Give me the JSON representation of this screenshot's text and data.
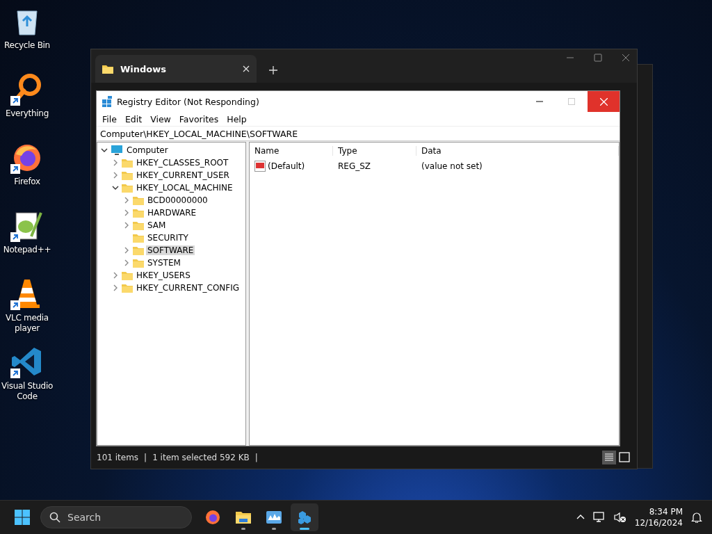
{
  "desktop_icons": [
    {
      "kind": "recycle-bin",
      "label": "Recycle Bin",
      "shortcut": false
    },
    {
      "kind": "everything",
      "label": "Everything",
      "shortcut": true
    },
    {
      "kind": "firefox",
      "label": "Firefox",
      "shortcut": true
    },
    {
      "kind": "notepad",
      "label": "Notepad++",
      "shortcut": true
    },
    {
      "kind": "vlc",
      "label": "VLC media player",
      "shortcut": true
    },
    {
      "kind": "vscode",
      "label": "Visual Studio Code",
      "shortcut": true
    }
  ],
  "explorer": {
    "tab_title": "Windows",
    "status_bar": [
      "101 items",
      "|",
      "1 item selected  592 KB",
      "|"
    ]
  },
  "registry_editor": {
    "title": "Registry Editor (Not Responding)",
    "menu": [
      "File",
      "Edit",
      "View",
      "Favorites",
      "Help"
    ],
    "address": "Computer\\HKEY_LOCAL_MACHINE\\SOFTWARE",
    "tree": [
      {
        "label": "Computer",
        "kind": "computer",
        "expandable": true,
        "expanded": true,
        "selected": false,
        "children": [
          {
            "label": "HKEY_CLASSES_ROOT",
            "expandable": true,
            "expanded": false,
            "selected": false
          },
          {
            "label": "HKEY_CURRENT_USER",
            "expandable": true,
            "expanded": false,
            "selected": false
          },
          {
            "label": "HKEY_LOCAL_MACHINE",
            "expandable": true,
            "expanded": true,
            "selected": false,
            "children": [
              {
                "label": "BCD00000000",
                "expandable": true,
                "expanded": false,
                "selected": false
              },
              {
                "label": "HARDWARE",
                "expandable": true,
                "expanded": false,
                "selected": false
              },
              {
                "label": "SAM",
                "expandable": true,
                "expanded": false,
                "selected": false
              },
              {
                "label": "SECURITY",
                "expandable": false,
                "expanded": false,
                "selected": false
              },
              {
                "label": "SOFTWARE",
                "expandable": true,
                "expanded": false,
                "selected": true
              },
              {
                "label": "SYSTEM",
                "expandable": true,
                "expanded": false,
                "selected": false
              }
            ]
          },
          {
            "label": "HKEY_USERS",
            "expandable": true,
            "expanded": false,
            "selected": false
          },
          {
            "label": "HKEY_CURRENT_CONFIG",
            "expandable": true,
            "expanded": false,
            "selected": false
          }
        ]
      }
    ],
    "columns": [
      "Name",
      "Type",
      "Data"
    ],
    "rows": [
      {
        "name": "(Default)",
        "type": "REG_SZ",
        "data": "(value not set)"
      }
    ]
  },
  "taskbar": {
    "search_placeholder": "Search",
    "apps": [
      {
        "kind": "firefox",
        "running": false,
        "active": false
      },
      {
        "kind": "file-explorer",
        "running": true,
        "active": false
      },
      {
        "kind": "task-manager",
        "running": true,
        "active": false
      },
      {
        "kind": "registry-editor",
        "running": true,
        "active": true
      }
    ],
    "time": "8:34 PM",
    "date": "12/16/2024"
  }
}
